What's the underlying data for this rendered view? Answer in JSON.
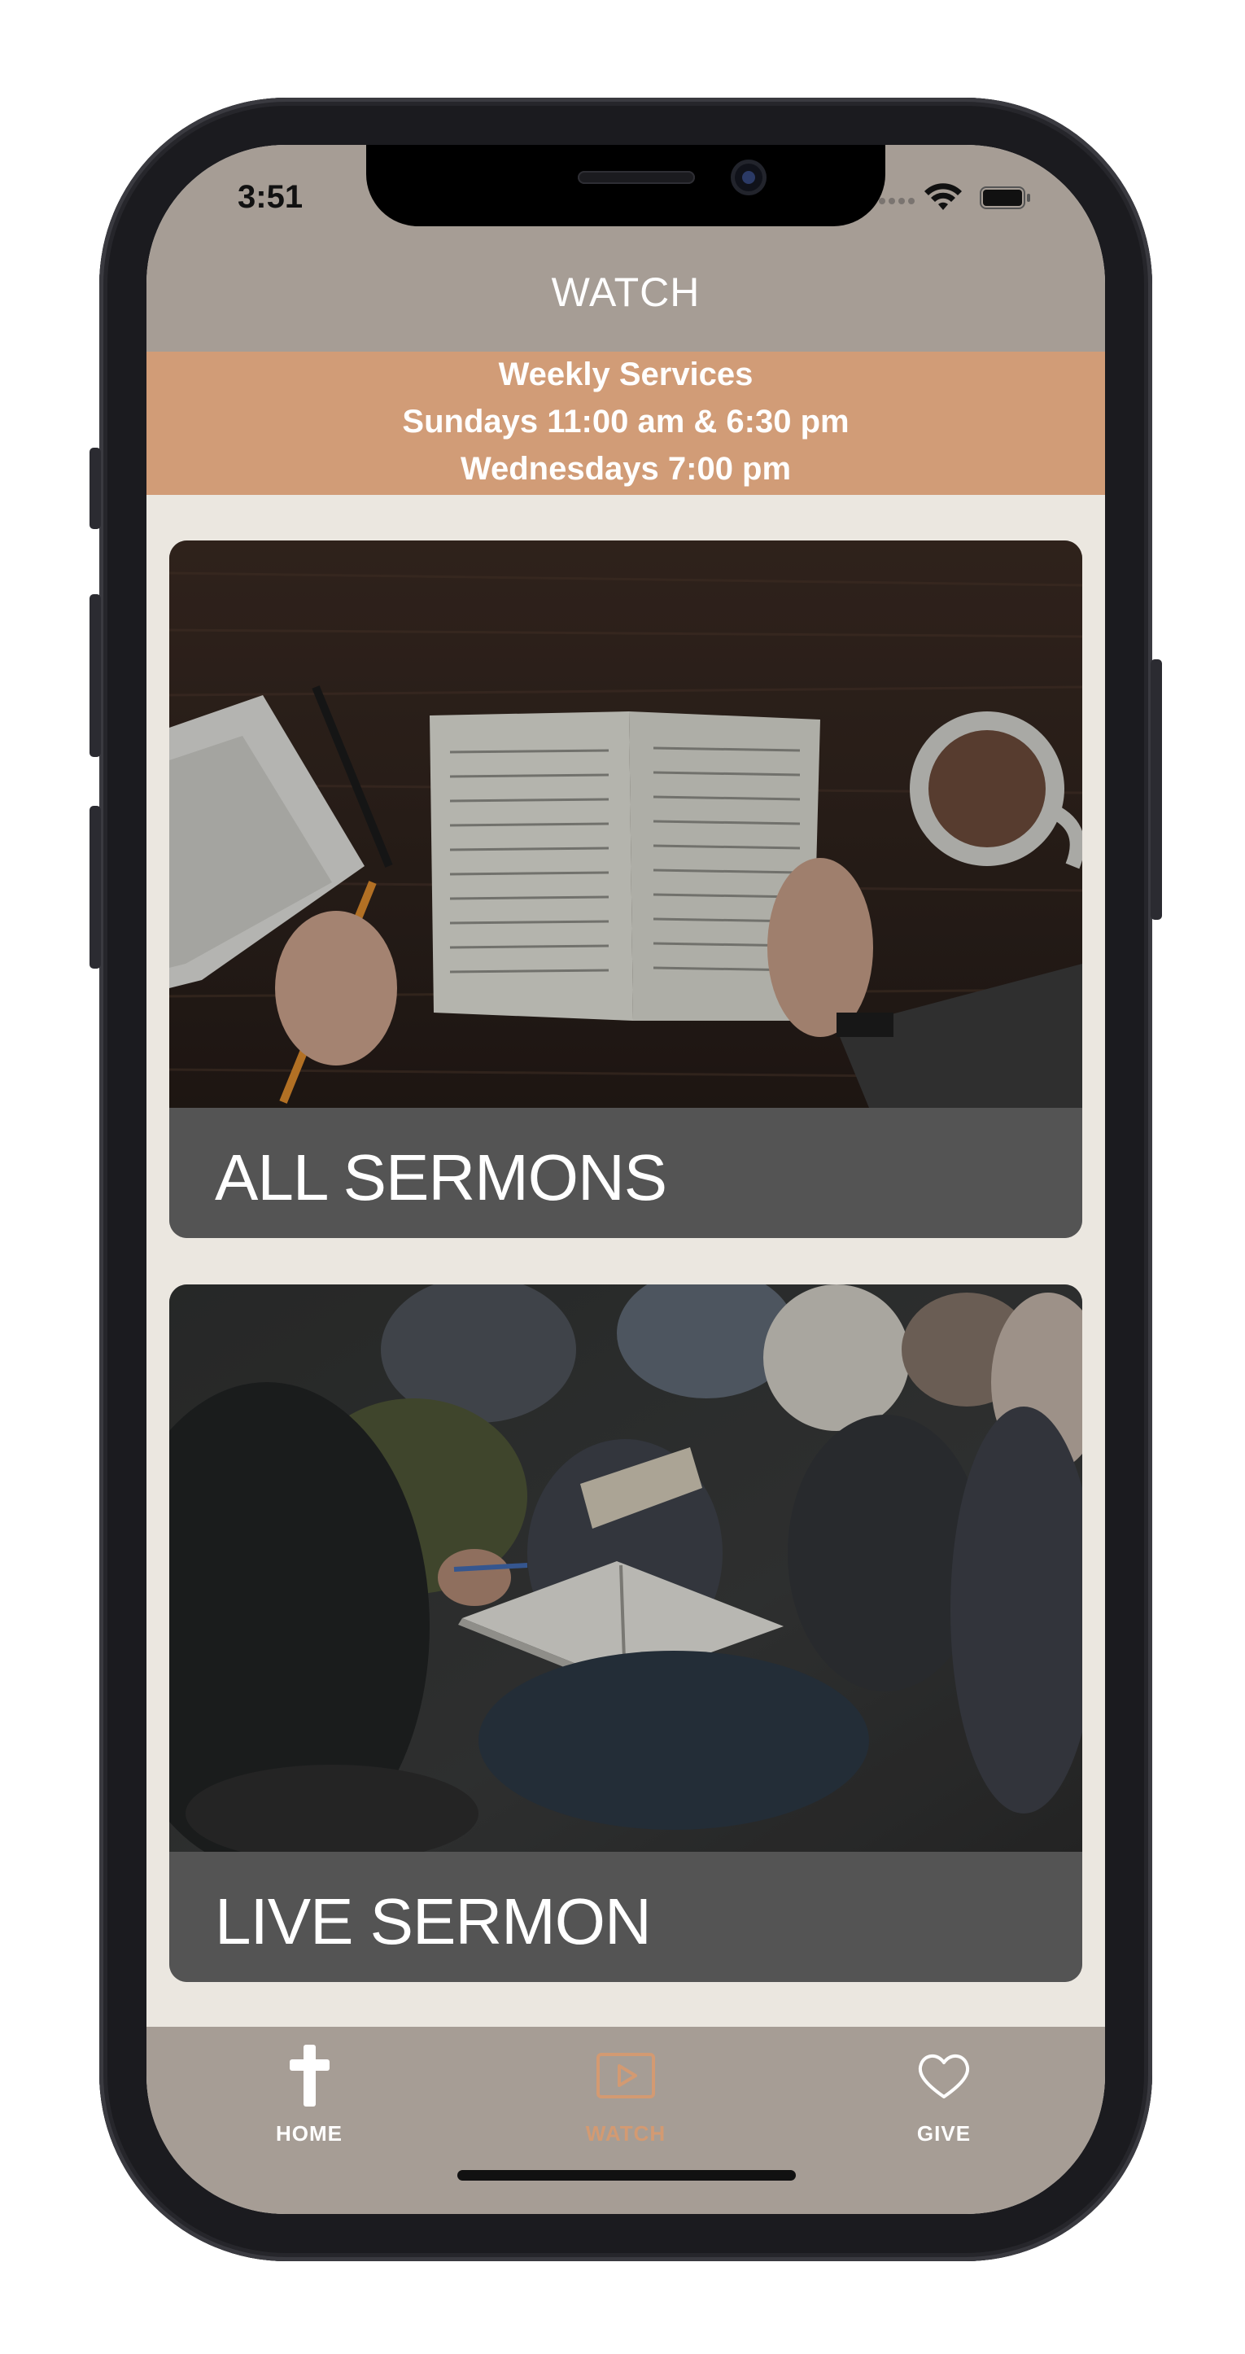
{
  "status_bar": {
    "time": "3:51"
  },
  "header": {
    "title": "WATCH"
  },
  "services": {
    "line1": "Weekly Services",
    "line2": "Sundays 11:00 am & 6:30 pm",
    "line3": "Wednesdays 7:00 pm"
  },
  "cards": [
    {
      "label": "ALL SERMONS",
      "image": "bible-study-photo"
    },
    {
      "label": "LIVE SERMON",
      "image": "congregation-photo"
    }
  ],
  "tabs": [
    {
      "label": "HOME",
      "icon": "cross-icon",
      "active": false
    },
    {
      "label": "WATCH",
      "icon": "play-icon",
      "active": true
    },
    {
      "label": "GIVE",
      "icon": "heart-icon",
      "active": false
    }
  ],
  "colors": {
    "header_bg": "#a69d95",
    "banner_bg": "#d19c77",
    "page_bg": "#ebe7e0",
    "card_label_bg": "#545454",
    "tab_active": "#d39a72",
    "tab_inactive": "#ffffff"
  }
}
